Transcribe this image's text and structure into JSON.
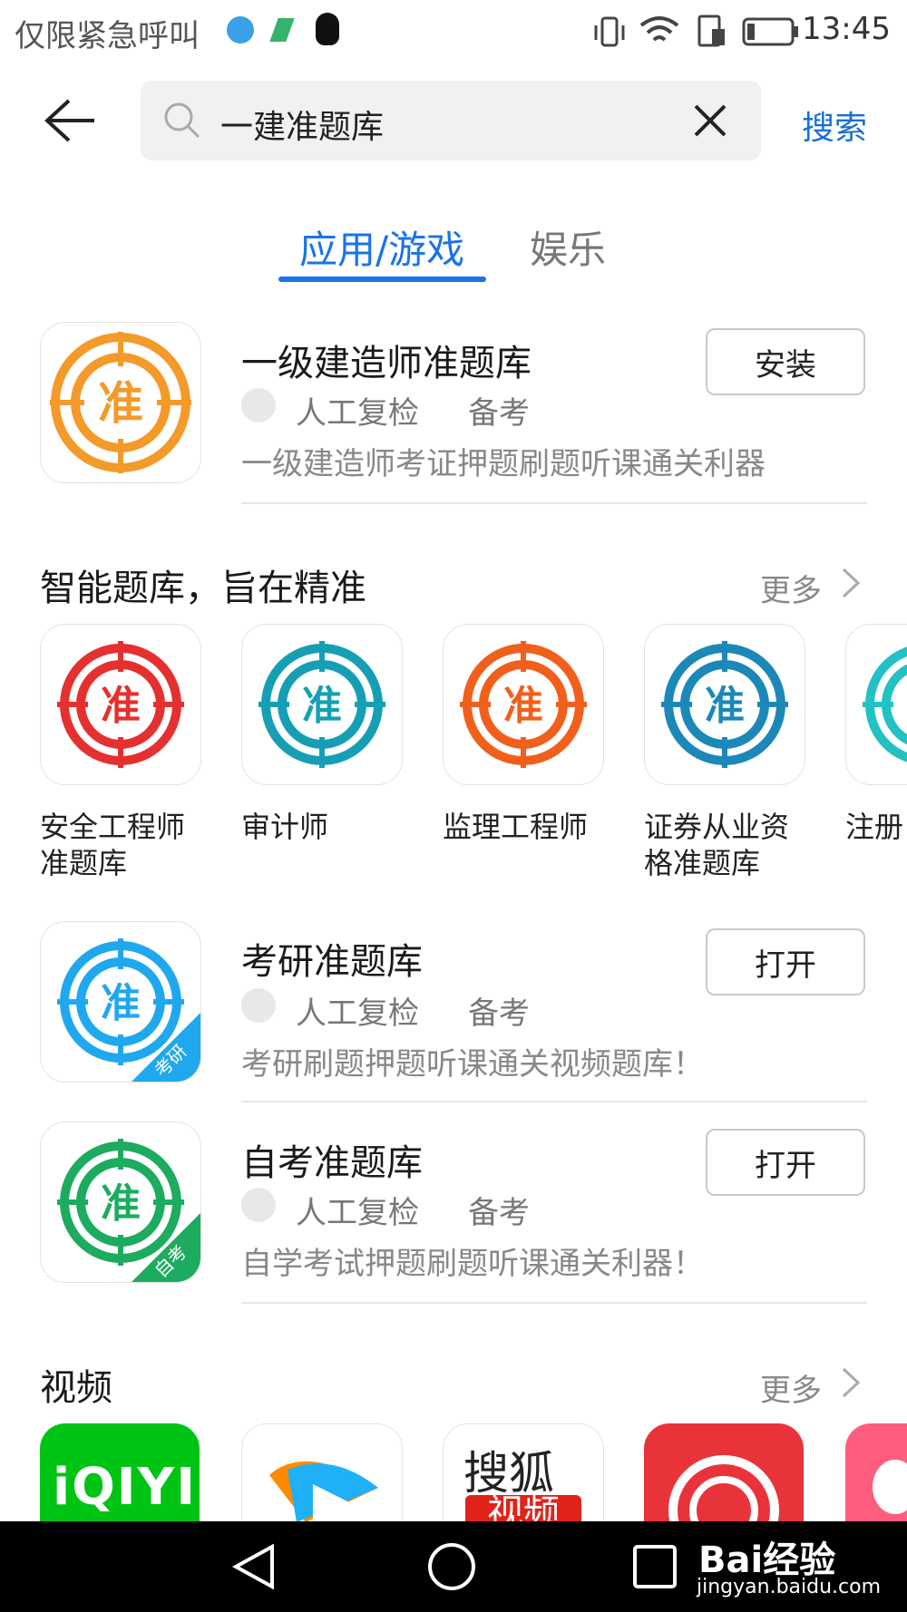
{
  "status_bar": {
    "carrier": "仅限紧急呼叫",
    "time": "13:45"
  },
  "header": {
    "query": "一建准题库",
    "search_label": "搜索"
  },
  "tabs": [
    {
      "label": "应用/游戏"
    },
    {
      "label": "娱乐"
    }
  ],
  "top_app": {
    "title": "一级建造师准题库",
    "check": "人工复检",
    "category": "备考",
    "desc": "一级建造师考证押题刷题听课通关利器",
    "action": "安装",
    "icon_glyph": "准",
    "icon_color": "#f39a2a"
  },
  "section1": {
    "title": "智能题库，旨在精准",
    "more": "更多",
    "items": [
      {
        "label": "安全工程师准题库",
        "glyph": "准",
        "color": "#e53030"
      },
      {
        "label": "审计师",
        "glyph": "准",
        "color": "#169fb4"
      },
      {
        "label": "监理工程师",
        "glyph": "准",
        "color": "#f0601c"
      },
      {
        "label": "证券从业资格准题库",
        "glyph": "准",
        "color": "#1b88b8"
      },
      {
        "label": "注册",
        "glyph": "准",
        "color": "#22c1c3"
      }
    ]
  },
  "apps": [
    {
      "title": "考研准题库",
      "check": "人工复检",
      "category": "备考",
      "desc": "考研刷题押题听课通关视频题库！",
      "action": "打开",
      "glyph": "准",
      "color": "#20a8ee",
      "ribbon": "考研",
      "ribbon_color": "#20a8ee"
    },
    {
      "title": "自考准题库",
      "check": "人工复检",
      "category": "备考",
      "desc": "自学考试押题刷题听课通关利器！",
      "action": "打开",
      "glyph": "准",
      "color": "#1dab5f",
      "ribbon": "自考",
      "ribbon_color": "#1dab5f"
    }
  ],
  "section2": {
    "title": "视频",
    "more": "更多",
    "sohu_text": "搜狐",
    "sohu_text2": "视频",
    "iqiyi_text": "iQIYI"
  },
  "watermark": {
    "brand": "Bai经验",
    "url": "jingyan.baidu.com"
  }
}
